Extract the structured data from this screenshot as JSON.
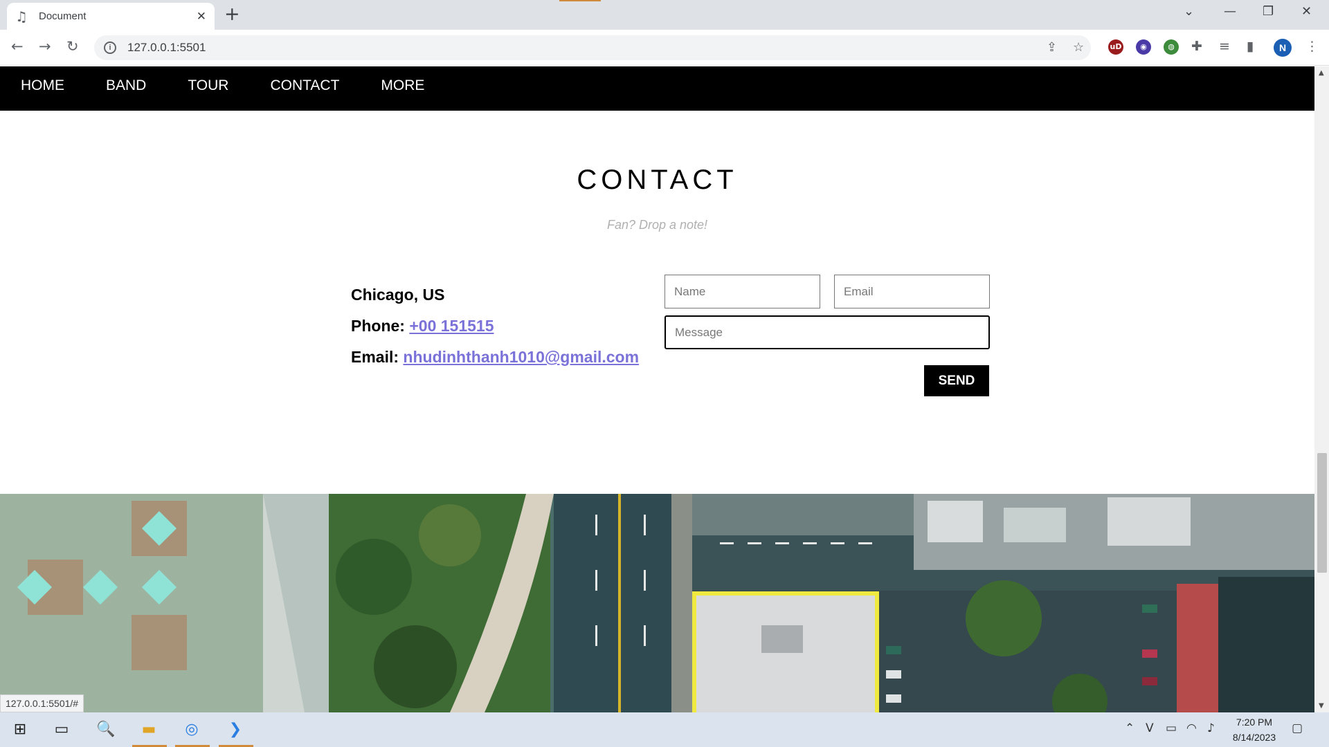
{
  "browser": {
    "tab_title": "Document",
    "tab_favicon": "music-note-icon",
    "url": "127.0.0.1:5501",
    "status_url": "127.0.0.1:5501/#",
    "profile_initial": "N",
    "accent_color": "#d08a3b"
  },
  "site": {
    "nav": [
      "HOME",
      "BAND",
      "TOUR",
      "CONTACT",
      "MORE"
    ],
    "contact": {
      "title": "CONTACT",
      "subtitle": "Fan? Drop a note!",
      "city": "Chicago, US",
      "phone_label": "Phone:",
      "phone": "+00 151515",
      "email_label": "Email:",
      "email": "nhudinhthanh1010@gmail.com",
      "form": {
        "name_placeholder": "Name",
        "email_placeholder": "Email",
        "message_placeholder": "Message",
        "send_label": "SEND"
      }
    }
  },
  "taskbar": {
    "time": "7:20 PM",
    "date": "8/14/2023"
  }
}
